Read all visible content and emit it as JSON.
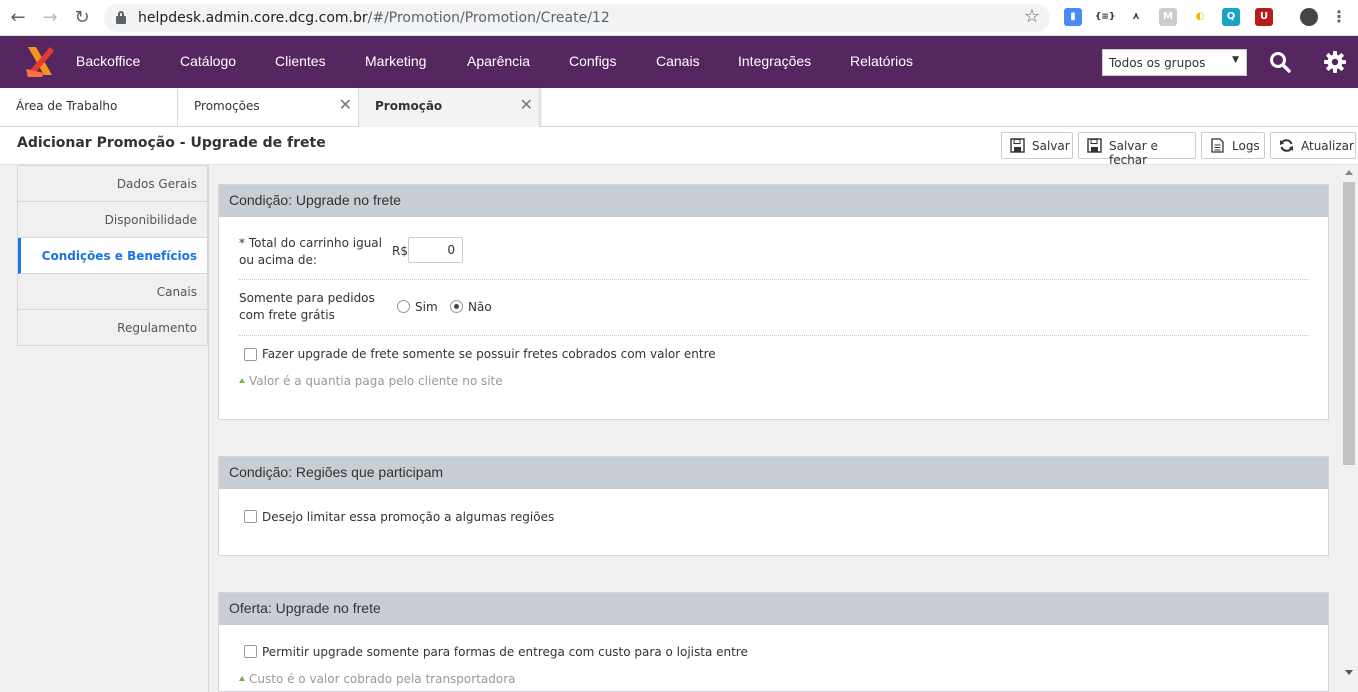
{
  "browser": {
    "url_host": "helpdesk.admin.core.dcg.com.br",
    "url_path": "/#/Promotion/Promotion/Create/12"
  },
  "topnav": {
    "items": [
      "Backoffice",
      "Catálogo",
      "Clientes",
      "Marketing",
      "Aparência",
      "Configs",
      "Canais",
      "Integrações",
      "Relatórios"
    ],
    "group_select": "Todos os grupos",
    "colors": {
      "bar": "#55265f",
      "logo_orange": "#f7941d",
      "logo_red": "#e53935"
    }
  },
  "tabs": [
    {
      "label": "Área de Trabalho"
    },
    {
      "label": "Promoções"
    },
    {
      "label": "Promoção"
    }
  ],
  "page": {
    "title": "Adicionar Promoção - Upgrade de frete",
    "buttons": {
      "save": "Salvar",
      "save_close": "Salvar e fechar",
      "logs": "Logs",
      "refresh": "Atualizar"
    }
  },
  "sidemenu": {
    "items": [
      "Dados Gerais",
      "Disponibilidade",
      "Condições e Benefícios",
      "Canais",
      "Regulamento"
    ],
    "active": "Condições e Benefícios"
  },
  "panel1": {
    "title": "Condição: Upgrade no frete",
    "total_label_1": "* Total do carrinho igual",
    "total_label_2": "ou acima de:",
    "currency": "R$",
    "total_value": "0",
    "free_label_1": "Somente para pedidos",
    "free_label_2": "com frete grátis",
    "opt_yes": "Sim",
    "opt_no": "Não",
    "selected": "Não",
    "checkbox": "Fazer upgrade de frete somente se possuir fretes cobrados com valor entre",
    "hint": "Valor é a quantia paga pelo cliente no site"
  },
  "panel2": {
    "title": "Condição: Regiões que participam",
    "checkbox": "Desejo limitar essa promoção a algumas regiões"
  },
  "panel3": {
    "title": "Oferta: Upgrade no frete",
    "checkbox": "Permitir upgrade somente para formas de entrega com custo para o lojista entre",
    "hint": "Custo é o valor cobrado pela transportadora"
  }
}
